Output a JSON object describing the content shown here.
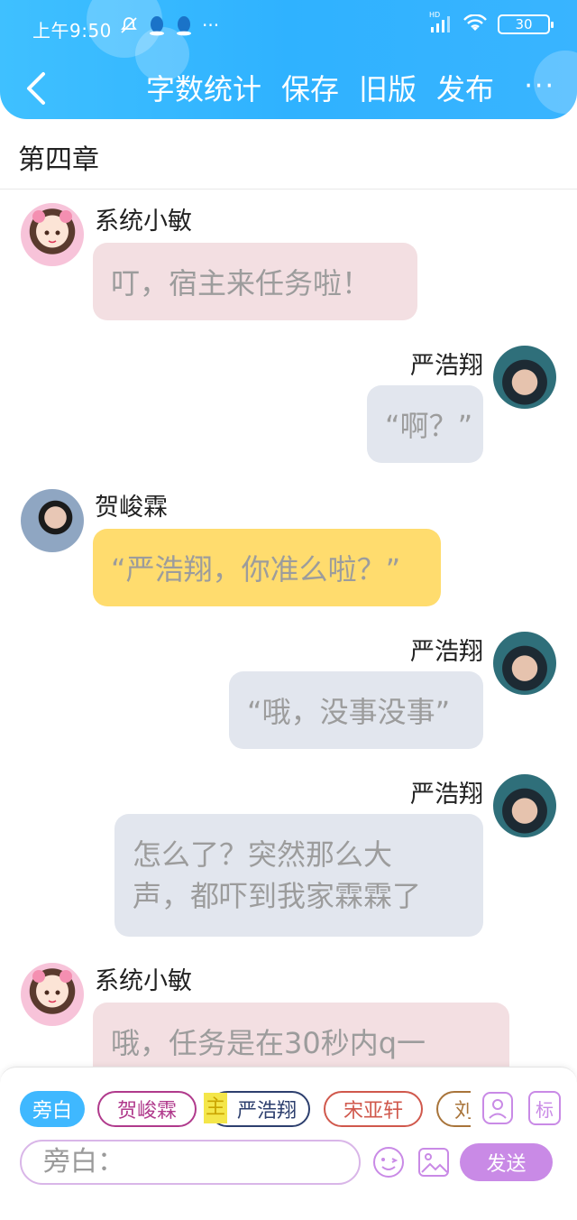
{
  "status_bar": {
    "time": "上午9:50",
    "more": "···",
    "battery": "30",
    "hd": "HD"
  },
  "nav": {
    "actions": [
      "字数统计",
      "保存",
      "旧版",
      "发布"
    ],
    "more": "···"
  },
  "chapter_title": "第四章",
  "messages": [
    {
      "side": "left",
      "name": "系统小敏",
      "text": "叮，宿主来任务啦！",
      "bubble_color": "#f3dfe2",
      "avatar": "anime-girl"
    },
    {
      "side": "right",
      "name": "严浩翔",
      "text": "“啊？”",
      "bubble_color": "#e2e6ee",
      "avatar": "male-portrait"
    },
    {
      "side": "left",
      "name": "贺峻霖",
      "text": "“严浩翔，你准么啦？”",
      "bubble_color": "#ffdc6e",
      "avatar": "male-portrait"
    },
    {
      "side": "right",
      "name": "严浩翔",
      "text": "“哦，没事没事”",
      "bubble_color": "#e2e6ee",
      "avatar": "male-portrait"
    },
    {
      "side": "right",
      "name": "严浩翔",
      "text_lines": [
        "怎么了？突然那么大",
        "声，都吓到我家霖霖了"
      ],
      "bubble_color": "#e2e6ee",
      "avatar": "male-portrait"
    },
    {
      "side": "left",
      "name": "系统小敏",
      "text": "哦，任务是在30秒内q一",
      "bubble_color": "#f3dfe2",
      "avatar": "anime-girl"
    }
  ],
  "roles": [
    {
      "label": "旁白",
      "color": "#3fb8ff",
      "filled": true
    },
    {
      "label": "贺峻霖",
      "color": "#b03a8c",
      "filled": false
    },
    {
      "label": "严浩翔",
      "color": "#2d3f6e",
      "filled": false,
      "tag": "主"
    },
    {
      "label": "宋亚轩",
      "color": "#d0584c",
      "filled": false
    },
    {
      "label": "刘",
      "color": "#a8743a",
      "filled": false
    }
  ],
  "role_tools": {
    "tag_label": "标"
  },
  "composer": {
    "placeholder": "旁白：",
    "send_label": "发送"
  },
  "colors": {
    "header_start": "#3fc0ff",
    "header_end": "#39b4ff",
    "send": "#c98ae6"
  }
}
